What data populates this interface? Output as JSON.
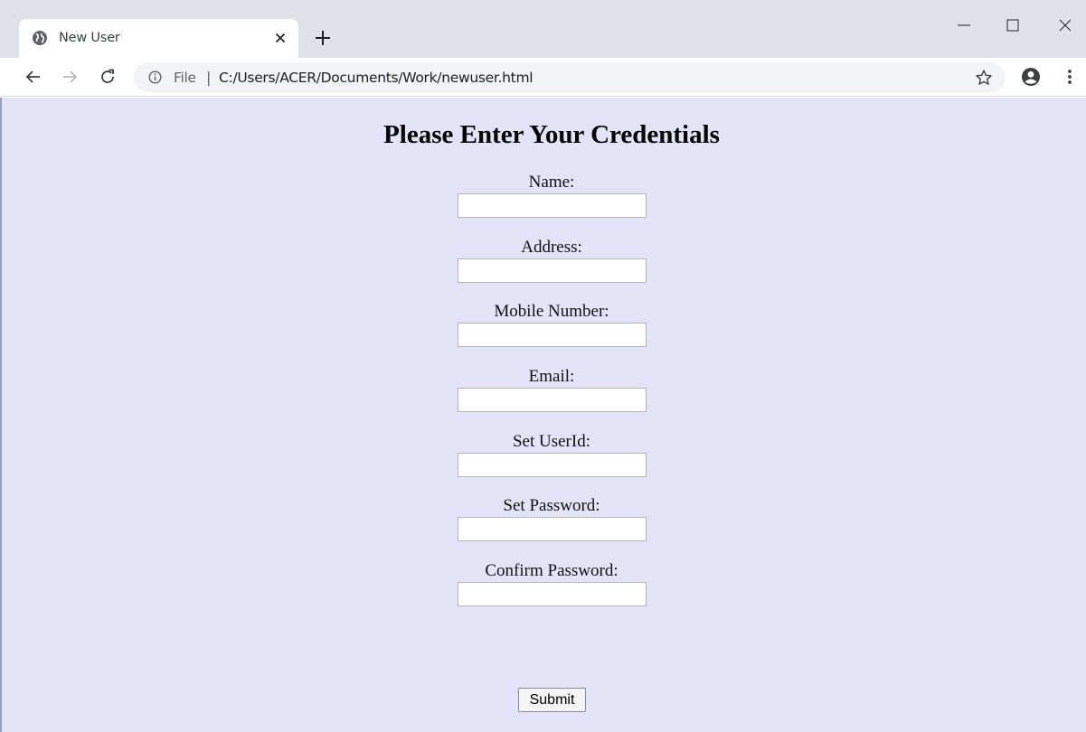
{
  "browser": {
    "tab": {
      "title": "New User",
      "favicon": "globe-icon"
    },
    "omnibox": {
      "scheme_label": "File",
      "separator": "|",
      "url": "C:/Users/ACER/Documents/Work/newuser.html"
    },
    "icons": [
      "back-arrow-icon",
      "forward-arrow-icon",
      "reload-icon",
      "info-icon",
      "star-icon",
      "account-icon",
      "menu-icon",
      "minimize-icon",
      "maximize-icon",
      "close-icon",
      "new-tab-icon"
    ]
  },
  "page": {
    "background": "#e3e3f8",
    "title": "Please Enter Your Credentials",
    "fields": [
      {
        "label": "Name:",
        "value": ""
      },
      {
        "label": "Address:",
        "value": ""
      },
      {
        "label": "Mobile Number:",
        "value": ""
      },
      {
        "label": "Email:",
        "value": ""
      },
      {
        "label": "Set UserId:",
        "value": ""
      },
      {
        "label": "Set Password:",
        "value": ""
      },
      {
        "label": "Confirm Password:",
        "value": ""
      }
    ],
    "submit_label": "Submit"
  }
}
